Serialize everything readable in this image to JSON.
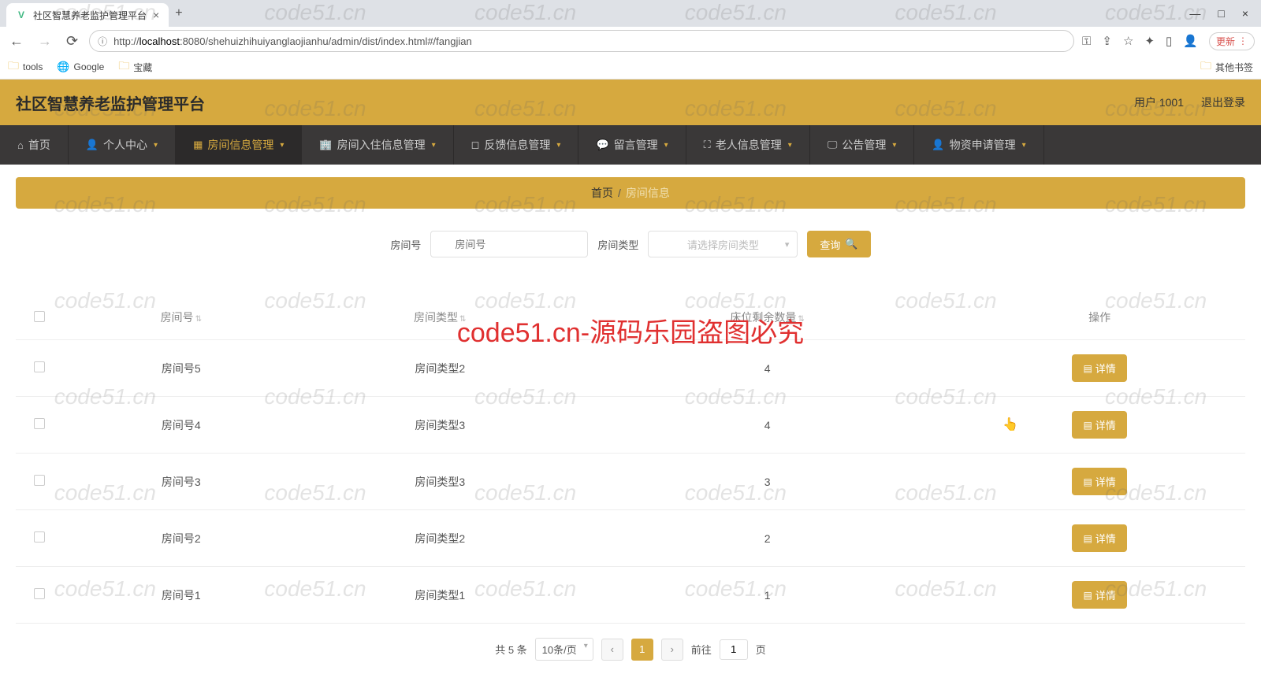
{
  "browser": {
    "tab_title": "社区智慧养老监护管理平台",
    "url_prefix": "http://",
    "url_host": "localhost",
    "url_path": ":8080/shehuizhihuiyanglaojianhu/admin/dist/index.html#/fangjian",
    "update_label": "更新",
    "bookmarks": [
      "tools",
      "Google",
      "宝藏"
    ],
    "other_bookmarks": "其他书签"
  },
  "header": {
    "app_title": "社区智慧养老监护管理平台",
    "user_label": "用户 1001",
    "logout": "退出登录"
  },
  "nav": [
    {
      "label": "首页",
      "caret": false
    },
    {
      "label": "个人中心",
      "caret": true
    },
    {
      "label": "房间信息管理",
      "caret": true,
      "active": true
    },
    {
      "label": "房间入住信息管理",
      "caret": true
    },
    {
      "label": "反馈信息管理",
      "caret": true
    },
    {
      "label": "留言管理",
      "caret": true
    },
    {
      "label": "老人信息管理",
      "caret": true
    },
    {
      "label": "公告管理",
      "caret": true
    },
    {
      "label": "物资申请管理",
      "caret": true
    }
  ],
  "breadcrumb": {
    "home": "首页",
    "sep": "/",
    "current": "房间信息"
  },
  "filters": {
    "room_label": "房间号",
    "room_placeholder": "房间号",
    "type_label": "房间类型",
    "type_placeholder": "请选择房间类型",
    "query_btn": "查询"
  },
  "table": {
    "cols": [
      "房间号",
      "房间类型",
      "床位剩余数量",
      "操作"
    ],
    "rows": [
      {
        "room": "房间号5",
        "type": "房间类型2",
        "remain": "4"
      },
      {
        "room": "房间号4",
        "type": "房间类型3",
        "remain": "4"
      },
      {
        "room": "房间号3",
        "type": "房间类型3",
        "remain": "3"
      },
      {
        "room": "房间号2",
        "type": "房间类型2",
        "remain": "2"
      },
      {
        "room": "房间号1",
        "type": "房间类型1",
        "remain": "1"
      }
    ],
    "detail_btn": "详情"
  },
  "pagination": {
    "total_label": "共 5 条",
    "page_size": "10条/页",
    "current": "1",
    "goto_label": "前往",
    "goto_value": "1",
    "page_label": "页"
  },
  "watermark": {
    "tile": "code51.cn",
    "big": "code51.cn-源码乐园盗图必究"
  }
}
